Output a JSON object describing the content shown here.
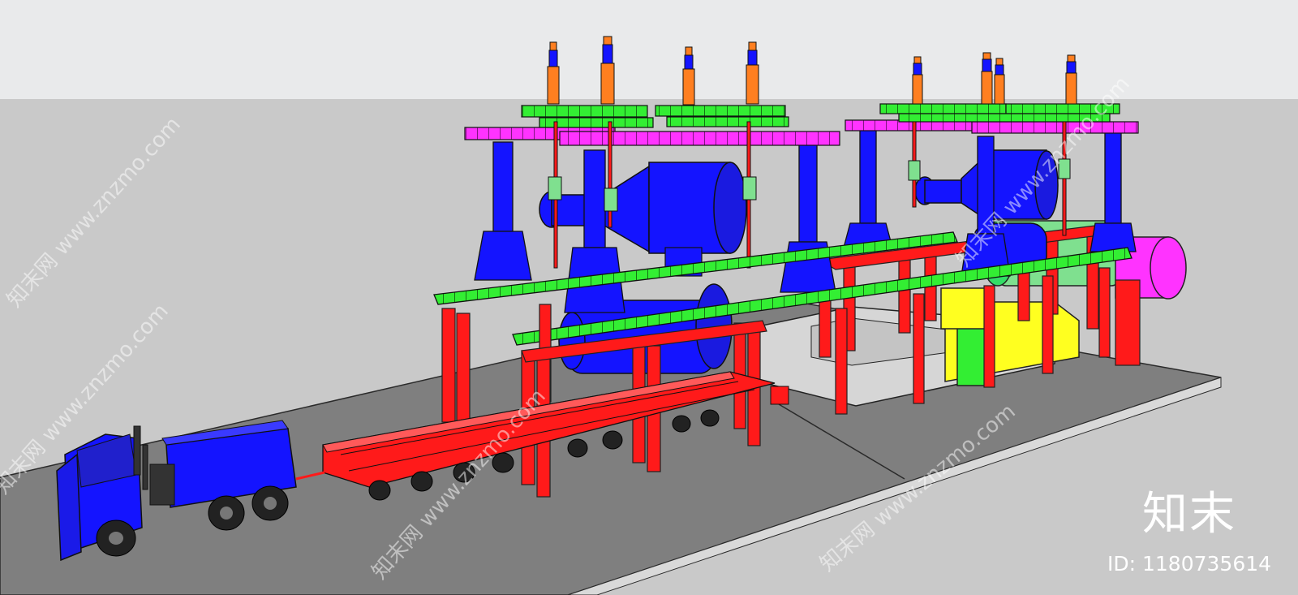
{
  "logo": {
    "text": "知末"
  },
  "id_label": "ID: 1180735614",
  "watermark": "知末网 www.znzmo.com",
  "colors": {
    "sky": "#e9eaeb",
    "ground": "#c9c9c9",
    "road": "#7f7f7f",
    "blue": "#1414ff",
    "red": "#ff1a1a",
    "green": "#33ee33",
    "magenta": "#ff33ff",
    "orange": "#ff7f20",
    "yellow": "#ffff20"
  }
}
